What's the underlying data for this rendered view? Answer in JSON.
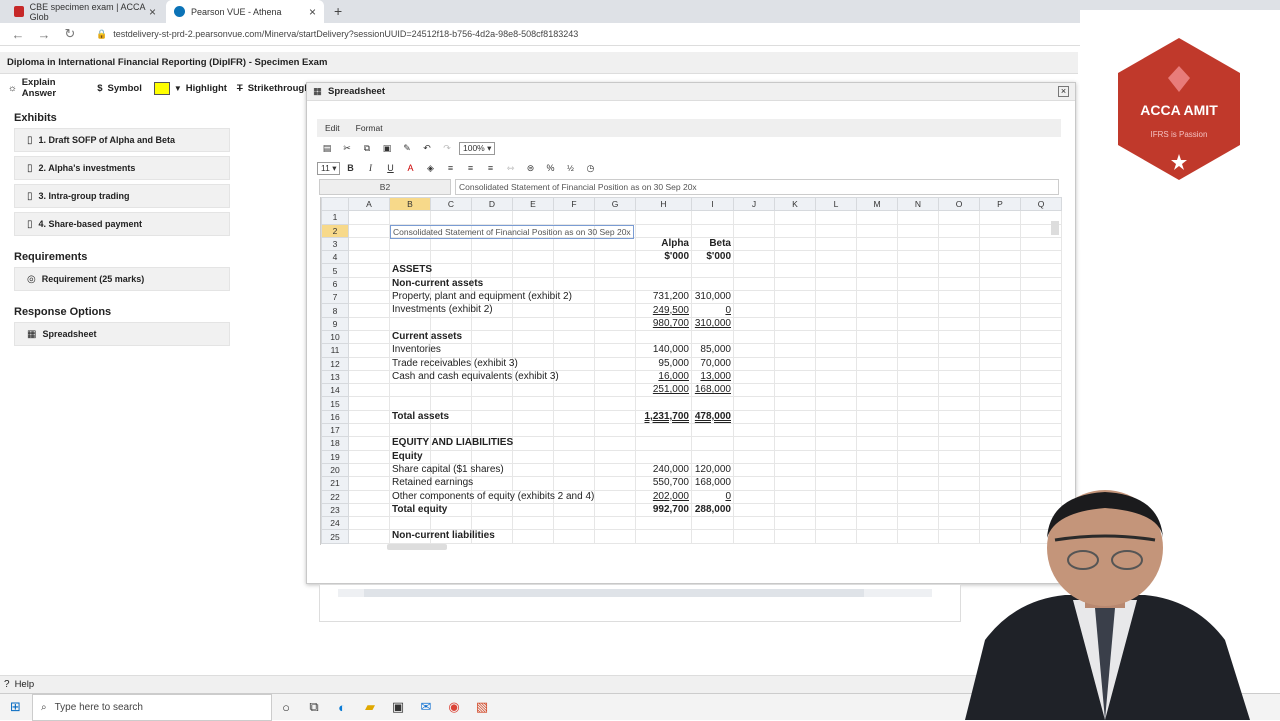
{
  "browser": {
    "tabs": [
      {
        "title": "CBE specimen exam | ACCA Glob",
        "active": false
      },
      {
        "title": "Pearson VUE - Athena",
        "active": true
      }
    ],
    "new_tab": "+",
    "url": "testdelivery-st-prd-2.pearsonvue.com/Minerva/startDelivery?sessionUUID=24512f18-b756-4d2a-98e8-508cf8183243"
  },
  "exam": {
    "title": "Diploma in International Financial Reporting (DipIFR) - Specimen Exam",
    "toolbar": {
      "explain": "Explain Answer",
      "symbol": "Symbol",
      "highlight": "Highlight",
      "strikethrough": "Strikethrough"
    }
  },
  "left_panel": {
    "exhibits_title": "Exhibits",
    "exhibits": [
      "1. Draft SOFP of Alpha and Beta",
      "2. Alpha's investments",
      "3. Intra-group trading",
      "4. Share-based payment"
    ],
    "requirements_title": "Requirements",
    "requirement": "Requirement (25 marks)",
    "response_title": "Response Options",
    "response": "Spreadsheet"
  },
  "spreadsheet": {
    "window_title": "Spreadsheet",
    "menu": [
      "Edit",
      "Format"
    ],
    "zoom": "100%",
    "font_size": "11",
    "cell_ref": "B2",
    "formula": "Consolidated Statement of Financial Position as on 30 Sep 20x",
    "columns": [
      "A",
      "B",
      "C",
      "D",
      "E",
      "F",
      "G",
      "H",
      "I",
      "J",
      "K",
      "L",
      "M",
      "N",
      "O",
      "P",
      "Q"
    ],
    "selected_column": "B",
    "selected_row": "2",
    "rows": [
      {
        "n": "1",
        "label": "",
        "h": "",
        "i": "",
        "bold": false
      },
      {
        "n": "2",
        "label": "Consolidated Statement of Financial Position as on 30 Sep 20x",
        "h": "",
        "i": "",
        "bold": false,
        "edit": true
      },
      {
        "n": "3",
        "label": "",
        "h": "Alpha",
        "i": "Beta",
        "bold": true
      },
      {
        "n": "4",
        "label": "",
        "h": "$'000",
        "i": "$'000",
        "bold": true
      },
      {
        "n": "5",
        "label": "ASSETS",
        "h": "",
        "i": "",
        "bold": true
      },
      {
        "n": "6",
        "label": "Non-current assets",
        "h": "",
        "i": "",
        "bold": true
      },
      {
        "n": "7",
        "label": "Property, plant and equipment (exhibit 2)",
        "h": "731,200",
        "i": "310,000",
        "bold": false
      },
      {
        "n": "8",
        "label": "Investments (exhibit 2)",
        "h": "249,500",
        "i": "0",
        "bold": false,
        "ul": true
      },
      {
        "n": "9",
        "label": "",
        "h": "980,700",
        "i": "310,000",
        "bold": false,
        "ul": true
      },
      {
        "n": "10",
        "label": "Current assets",
        "h": "",
        "i": "",
        "bold": true
      },
      {
        "n": "11",
        "label": "Inventories",
        "h": "140,000",
        "i": "85,000",
        "bold": false
      },
      {
        "n": "12",
        "label": "Trade receivables (exhibit 3)",
        "h": "95,000",
        "i": "70,000",
        "bold": false
      },
      {
        "n": "13",
        "label": "Cash and cash equivalents (exhibit 3)",
        "h": "16,000",
        "i": "13,000",
        "bold": false,
        "ul": true
      },
      {
        "n": "14",
        "label": "",
        "h": "251,000",
        "i": "168,000",
        "bold": false,
        "ul": true
      },
      {
        "n": "15",
        "label": "",
        "h": "",
        "i": "",
        "bold": false
      },
      {
        "n": "16",
        "label": "Total assets",
        "h": "1,231,700",
        "i": "478,000",
        "bold": true,
        "dul": true
      },
      {
        "n": "17",
        "label": "",
        "h": "",
        "i": "",
        "bold": false
      },
      {
        "n": "18",
        "label": "EQUITY AND LIABILITIES",
        "h": "",
        "i": "",
        "bold": true
      },
      {
        "n": "19",
        "label": "Equity",
        "h": "",
        "i": "",
        "bold": true
      },
      {
        "n": "20",
        "label": "Share capital ($1 shares)",
        "h": "240,000",
        "i": "120,000",
        "bold": false
      },
      {
        "n": "21",
        "label": "Retained earnings",
        "h": "550,700",
        "i": "168,000",
        "bold": false
      },
      {
        "n": "22",
        "label": "Other components of equity (exhibits 2 and 4)",
        "h": "202,000",
        "i": "0",
        "bold": false,
        "ul": true
      },
      {
        "n": "23",
        "label": "Total equity",
        "h": "992,700",
        "i": "288,000",
        "bold": true
      },
      {
        "n": "24",
        "label": "",
        "h": "",
        "i": "",
        "bold": false
      },
      {
        "n": "25",
        "label": "Non-current liabilities",
        "h": "",
        "i": "",
        "bold": true
      }
    ]
  },
  "footer": {
    "help": "Help"
  },
  "taskbar": {
    "search_placeholder": "Type here to search"
  },
  "branding": {
    "name": "ACCA AMIT",
    "tagline": "IFRS is Passion",
    "color": "#c0392b"
  }
}
